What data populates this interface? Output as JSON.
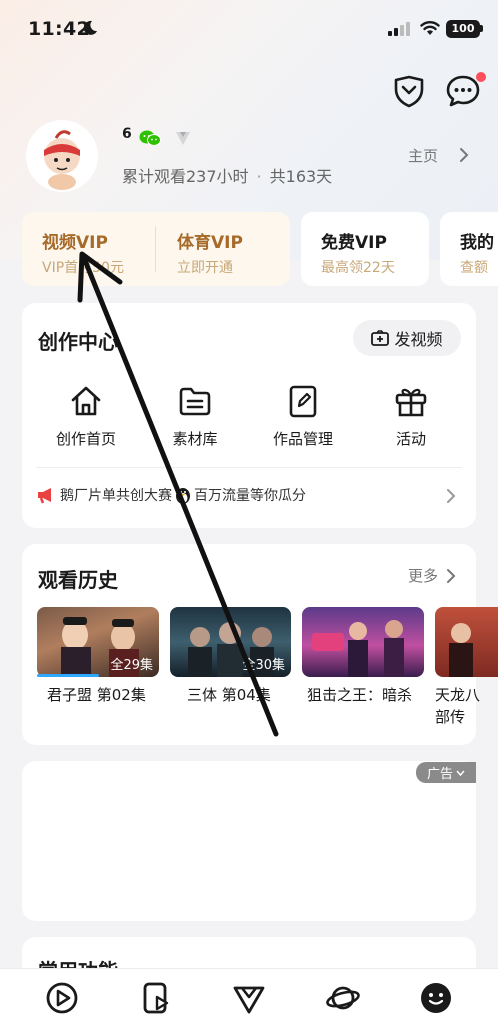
{
  "status_bar": {
    "time": "11:42",
    "battery": "100"
  },
  "profile": {
    "username": "6",
    "watch_time": "累计观看237小时",
    "days": "共163天",
    "homepage_link": "主页"
  },
  "vip_cards": {
    "video_vip": {
      "title": "视频VIP",
      "subtitle": "VIP首月50元"
    },
    "sports_vip": {
      "title": "体育VIP",
      "subtitle": "立即开通"
    },
    "free_vip": {
      "title": "免费VIP",
      "subtitle": "最高领22天"
    },
    "my_card": {
      "title": "我的",
      "subtitle": "查额"
    }
  },
  "creation_center": {
    "title": "创作中心",
    "post_video_label": "发视频",
    "features": [
      {
        "label": "创作首页",
        "icon": "home-icon"
      },
      {
        "label": "素材库",
        "icon": "folder-icon"
      },
      {
        "label": "作品管理",
        "icon": "edit-icon"
      },
      {
        "label": "活动",
        "icon": "gift-icon"
      }
    ],
    "notice": {
      "text_before": "鹅厂片单共创大赛",
      "text_after": "百万流量等你瓜分"
    }
  },
  "watch_history": {
    "title": "观看历史",
    "more_label": "更多",
    "items": [
      {
        "title": "君子盟 第02集",
        "episodes": "全29集",
        "progress": 0.55
      },
      {
        "title": "三体 第04集",
        "episodes": "全30集"
      },
      {
        "title": "狙击之王：暗杀",
        "episodes": ""
      },
      {
        "title": "天龙八部传",
        "episodes": ""
      }
    ]
  },
  "ad": {
    "label": "广告"
  },
  "common_functions": {
    "title": "常用功能"
  },
  "colors": {
    "accent_gold": "#a66a2a",
    "gold_light": "#c9a878",
    "progress_blue": "#2ea8ff",
    "notice_red": "#e94040",
    "badge_red": "#ff4d5a"
  }
}
